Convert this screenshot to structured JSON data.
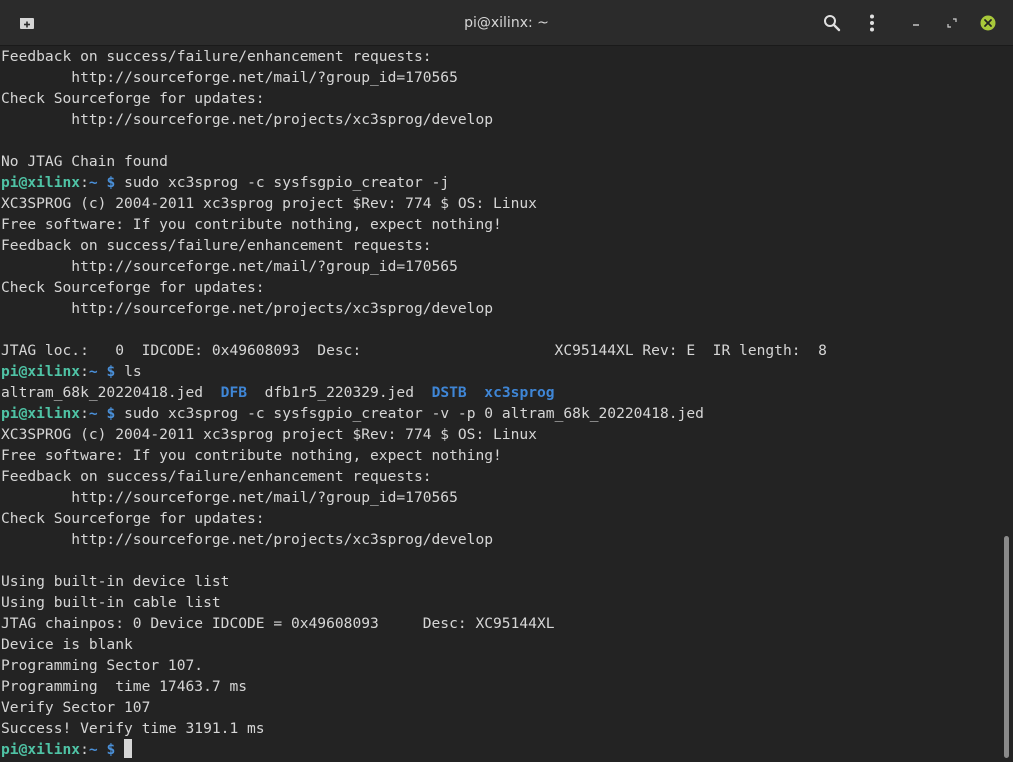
{
  "window": {
    "title": "pi@xilinx: ~"
  },
  "prompt": {
    "user_host": "pi@xilinx",
    "sep": ":",
    "path": "~",
    "dollar": "$"
  },
  "colors": {
    "prompt_green": "#4fc3a5",
    "prompt_blue": "#4a90d9",
    "dir_blue": "#3f86d6",
    "text": "#d6d6d6",
    "background": "#232323",
    "close_button": "#a8c83a"
  },
  "icons": {
    "new_tab": "new-tab-icon",
    "search": "search-icon",
    "menu": "kebab-menu-icon",
    "minimize": "minimize-icon",
    "maximize": "maximize-icon",
    "close": "close-icon"
  },
  "terminal": {
    "lines": [
      {
        "type": "text",
        "text": "Feedback on success/failure/enhancement requests:"
      },
      {
        "type": "text",
        "text": "        http://sourceforge.net/mail/?group_id=170565"
      },
      {
        "type": "text",
        "text": "Check Sourceforge for updates:"
      },
      {
        "type": "text",
        "text": "        http://sourceforge.net/projects/xc3sprog/develop"
      },
      {
        "type": "text",
        "text": ""
      },
      {
        "type": "text",
        "text": "No JTAG Chain found"
      },
      {
        "type": "prompt",
        "cmd": "sudo xc3sprog -c sysfsgpio_creator -j"
      },
      {
        "type": "text",
        "text": "XC3SPROG (c) 2004-2011 xc3sprog project $Rev: 774 $ OS: Linux"
      },
      {
        "type": "text",
        "text": "Free software: If you contribute nothing, expect nothing!"
      },
      {
        "type": "text",
        "text": "Feedback on success/failure/enhancement requests:"
      },
      {
        "type": "text",
        "text": "        http://sourceforge.net/mail/?group_id=170565"
      },
      {
        "type": "text",
        "text": "Check Sourceforge for updates:"
      },
      {
        "type": "text",
        "text": "        http://sourceforge.net/projects/xc3sprog/develop"
      },
      {
        "type": "text",
        "text": ""
      },
      {
        "type": "text",
        "text": "JTAG loc.:   0  IDCODE: 0x49608093  Desc:                      XC95144XL Rev: E  IR length:  8"
      },
      {
        "type": "prompt",
        "cmd": "ls"
      },
      {
        "type": "ls",
        "items": [
          {
            "name": "altram_68k_20220418.jed",
            "dir": false
          },
          {
            "name": "DFB",
            "dir": true
          },
          {
            "name": "dfb1r5_220329.jed",
            "dir": false
          },
          {
            "name": "DSTB",
            "dir": true
          },
          {
            "name": "xc3sprog",
            "dir": true
          }
        ]
      },
      {
        "type": "prompt",
        "cmd": "sudo xc3sprog -c sysfsgpio_creator -v -p 0 altram_68k_20220418.jed"
      },
      {
        "type": "text",
        "text": "XC3SPROG (c) 2004-2011 xc3sprog project $Rev: 774 $ OS: Linux"
      },
      {
        "type": "text",
        "text": "Free software: If you contribute nothing, expect nothing!"
      },
      {
        "type": "text",
        "text": "Feedback on success/failure/enhancement requests:"
      },
      {
        "type": "text",
        "text": "        http://sourceforge.net/mail/?group_id=170565"
      },
      {
        "type": "text",
        "text": "Check Sourceforge for updates:"
      },
      {
        "type": "text",
        "text": "        http://sourceforge.net/projects/xc3sprog/develop"
      },
      {
        "type": "text",
        "text": ""
      },
      {
        "type": "text",
        "text": "Using built-in device list"
      },
      {
        "type": "text",
        "text": "Using built-in cable list"
      },
      {
        "type": "text",
        "text": "JTAG chainpos: 0 Device IDCODE = 0x49608093     Desc: XC95144XL"
      },
      {
        "type": "text",
        "text": "Device is blank"
      },
      {
        "type": "text",
        "text": "Programming Sector 107."
      },
      {
        "type": "text",
        "text": "Programming  time 17463.7 ms"
      },
      {
        "type": "text",
        "text": "Verify Sector 107"
      },
      {
        "type": "text",
        "text": "Success! Verify time 3191.1 ms"
      },
      {
        "type": "prompt",
        "cmd": "",
        "cursor": true
      }
    ]
  }
}
